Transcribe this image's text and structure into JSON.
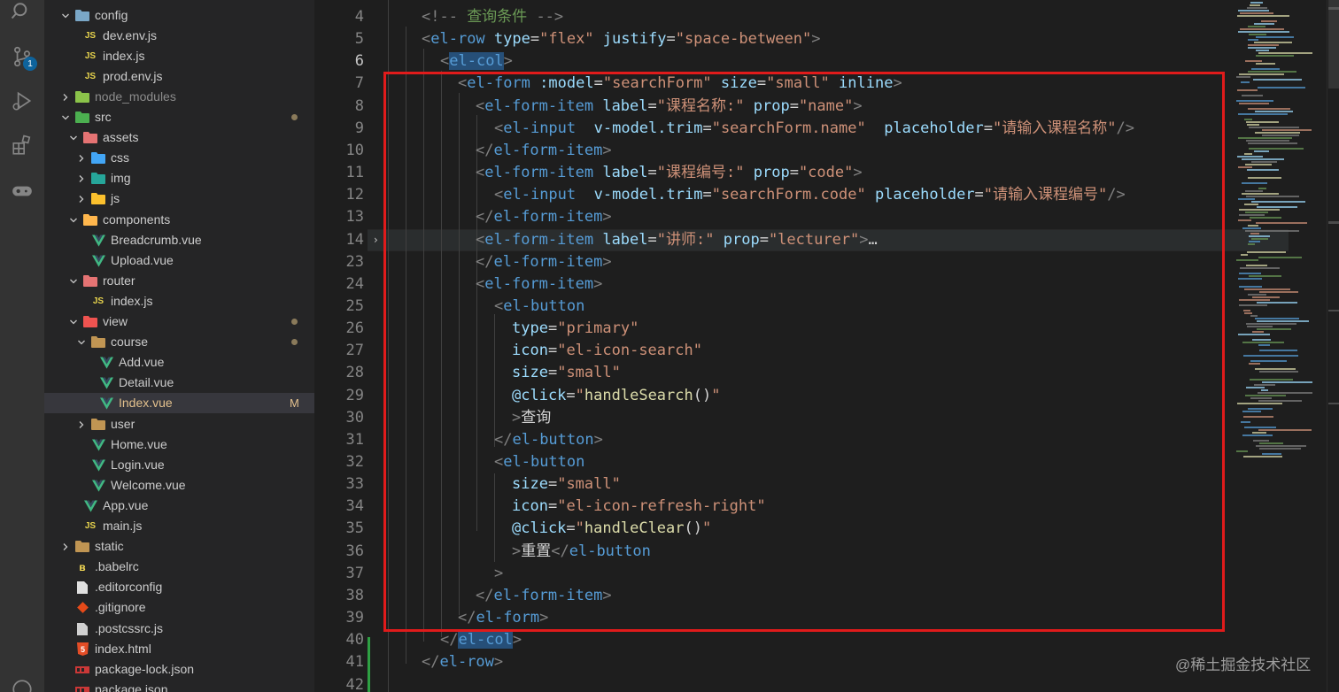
{
  "activity_bar": {
    "icons": [
      "search-icon",
      "source-control-icon",
      "run-debug-icon",
      "extensions-icon",
      "remote-icon"
    ],
    "scm_badge": "1"
  },
  "explorer": {
    "rows": [
      {
        "name": "config",
        "kind": "folder-open",
        "icon": "folder-config-icon",
        "color": "#7aa7c7"
      },
      {
        "name": "dev.env.js",
        "kind": "file",
        "icon": "js-file-icon",
        "color": "#e8d44d"
      },
      {
        "name": "index.js",
        "kind": "file",
        "icon": "js-file-icon",
        "color": "#e8d44d"
      },
      {
        "name": "prod.env.js",
        "kind": "file",
        "icon": "js-file-icon",
        "color": "#e8d44d"
      },
      {
        "name": "node_modules",
        "kind": "folder-closed",
        "icon": "folder-node-icon",
        "color": "#8bc34a"
      },
      {
        "name": "src",
        "kind": "folder-open",
        "icon": "folder-src-icon",
        "color": "#4caf50"
      },
      {
        "name": "assets",
        "kind": "folder-open",
        "icon": "folder-assets-icon",
        "color": "#e57373"
      },
      {
        "name": "css",
        "kind": "folder-closed",
        "icon": "folder-css-icon",
        "color": "#42a5f5"
      },
      {
        "name": "img",
        "kind": "folder-closed",
        "icon": "folder-images-icon",
        "color": "#26a69a"
      },
      {
        "name": "js",
        "kind": "folder-closed",
        "icon": "folder-js-icon",
        "color": "#fbc02d"
      },
      {
        "name": "components",
        "kind": "folder-open",
        "icon": "folder-components-icon",
        "color": "#ffb74d"
      },
      {
        "name": "Breadcrumb.vue",
        "kind": "file",
        "icon": "vue-file-icon",
        "color": "#41b883"
      },
      {
        "name": "Upload.vue",
        "kind": "file",
        "icon": "vue-file-icon",
        "color": "#41b883"
      },
      {
        "name": "router",
        "kind": "folder-open",
        "icon": "folder-router-icon",
        "color": "#e57373"
      },
      {
        "name": "index.js",
        "kind": "file",
        "icon": "js-file-icon",
        "color": "#e8d44d"
      },
      {
        "name": "view",
        "kind": "folder-open",
        "icon": "folder-view-icon",
        "color": "#ef5350"
      },
      {
        "name": "course",
        "kind": "folder-open",
        "icon": "folder-icon",
        "color": "#c09553"
      },
      {
        "name": "Add.vue",
        "kind": "file",
        "icon": "vue-file-icon",
        "color": "#41b883"
      },
      {
        "name": "Detail.vue",
        "kind": "file",
        "icon": "vue-file-icon",
        "color": "#41b883"
      },
      {
        "name": "Index.vue",
        "kind": "file",
        "icon": "vue-file-icon",
        "color": "#41b883"
      },
      {
        "name": "user",
        "kind": "folder-closed",
        "icon": "folder-icon",
        "color": "#c09553"
      },
      {
        "name": "Home.vue",
        "kind": "file",
        "icon": "vue-file-icon",
        "color": "#41b883"
      },
      {
        "name": "Login.vue",
        "kind": "file",
        "icon": "vue-file-icon",
        "color": "#41b883"
      },
      {
        "name": "Welcome.vue",
        "kind": "file",
        "icon": "vue-file-icon",
        "color": "#41b883"
      },
      {
        "name": "App.vue",
        "kind": "file",
        "icon": "vue-file-icon",
        "color": "#41b883"
      },
      {
        "name": "main.js",
        "kind": "file",
        "icon": "js-file-icon",
        "color": "#e8d44d"
      },
      {
        "name": "static",
        "kind": "folder-closed",
        "icon": "folder-icon",
        "color": "#c09553"
      },
      {
        "name": ".babelrc",
        "kind": "file",
        "icon": "babel-file-icon",
        "color": "#f5da55"
      },
      {
        "name": ".editorconfig",
        "kind": "file",
        "icon": "editorconfig-file-icon",
        "color": "#e0e0e0"
      },
      {
        "name": ".gitignore",
        "kind": "file",
        "icon": "git-file-icon",
        "color": "#e64a19"
      },
      {
        "name": ".postcssrc.js",
        "kind": "file",
        "icon": "postcss-file-icon",
        "color": "#d0d0d0"
      },
      {
        "name": "index.html",
        "kind": "file",
        "icon": "html-file-icon",
        "color": "#e44d26"
      },
      {
        "name": "package-lock.json",
        "kind": "file",
        "icon": "npm-file-icon",
        "color": "#cb3837"
      },
      {
        "name": "package.json",
        "kind": "file",
        "icon": "npm-file-icon",
        "color": "#cb3837"
      }
    ],
    "selected_file": "Index.vue",
    "modified_flag": "M"
  },
  "editor": {
    "active_line": "6",
    "line_numbers": [
      "4",
      "5",
      "6",
      "7",
      "8",
      "9",
      "10",
      "11",
      "12",
      "13",
      "14",
      "23",
      "24",
      "25",
      "26",
      "27",
      "28",
      "29",
      "30",
      "31",
      "32",
      "33",
      "34",
      "35",
      "36",
      "37",
      "38",
      "39",
      "40",
      "41",
      "42"
    ],
    "lines": [
      [
        [
          "t-punc",
          "<!-- "
        ],
        [
          "t-comm",
          "查询条件 "
        ],
        [
          "t-punc",
          "-->"
        ]
      ],
      [
        [
          "t-punc",
          "<"
        ],
        [
          "t-tag",
          "el-row"
        ],
        [
          "t-text",
          " "
        ],
        [
          "t-attr",
          "type"
        ],
        [
          "t-text",
          "="
        ],
        [
          "t-str",
          "\"flex\""
        ],
        [
          "t-text",
          " "
        ],
        [
          "t-attr",
          "justify"
        ],
        [
          "t-text",
          "="
        ],
        [
          "t-str",
          "\"space-between\""
        ],
        [
          "t-punc",
          ">"
        ]
      ],
      [
        [
          "t-punc",
          "<"
        ],
        [
          "t-hl",
          "el-col"
        ],
        [
          "t-punc",
          ">"
        ]
      ],
      [
        [
          "t-punc",
          "<"
        ],
        [
          "t-tag",
          "el-form"
        ],
        [
          "t-text",
          " "
        ],
        [
          "t-attr",
          ":model"
        ],
        [
          "t-text",
          "="
        ],
        [
          "t-str",
          "\"searchForm\""
        ],
        [
          "t-text",
          " "
        ],
        [
          "t-attr",
          "size"
        ],
        [
          "t-text",
          "="
        ],
        [
          "t-str",
          "\"small\""
        ],
        [
          "t-text",
          " "
        ],
        [
          "t-attr",
          "inline"
        ],
        [
          "t-punc",
          ">"
        ]
      ],
      [
        [
          "t-punc",
          "<"
        ],
        [
          "t-tag",
          "el-form-item"
        ],
        [
          "t-text",
          " "
        ],
        [
          "t-attr",
          "label"
        ],
        [
          "t-text",
          "="
        ],
        [
          "t-str",
          "\"课程名称:\""
        ],
        [
          "t-text",
          " "
        ],
        [
          "t-attr",
          "prop"
        ],
        [
          "t-text",
          "="
        ],
        [
          "t-str",
          "\"name\""
        ],
        [
          "t-punc",
          ">"
        ]
      ],
      [
        [
          "t-punc",
          "<"
        ],
        [
          "t-tag",
          "el-input"
        ],
        [
          "t-text",
          "  "
        ],
        [
          "t-attr",
          "v-model.trim"
        ],
        [
          "t-text",
          "="
        ],
        [
          "t-str",
          "\"searchForm.name\""
        ],
        [
          "t-text",
          "  "
        ],
        [
          "t-attr",
          "placeholder"
        ],
        [
          "t-text",
          "="
        ],
        [
          "t-str",
          "\"请输入课程名称\""
        ],
        [
          "t-punc",
          "/>"
        ]
      ],
      [
        [
          "t-punc",
          "</"
        ],
        [
          "t-tag",
          "el-form-item"
        ],
        [
          "t-punc",
          ">"
        ]
      ],
      [
        [
          "t-punc",
          "<"
        ],
        [
          "t-tag",
          "el-form-item"
        ],
        [
          "t-text",
          " "
        ],
        [
          "t-attr",
          "label"
        ],
        [
          "t-text",
          "="
        ],
        [
          "t-str",
          "\"课程编号:\""
        ],
        [
          "t-text",
          " "
        ],
        [
          "t-attr",
          "prop"
        ],
        [
          "t-text",
          "="
        ],
        [
          "t-str",
          "\"code\""
        ],
        [
          "t-punc",
          ">"
        ]
      ],
      [
        [
          "t-punc",
          "<"
        ],
        [
          "t-tag",
          "el-input"
        ],
        [
          "t-text",
          "  "
        ],
        [
          "t-attr",
          "v-model.trim"
        ],
        [
          "t-text",
          "="
        ],
        [
          "t-str",
          "\"searchForm.code\""
        ],
        [
          "t-text",
          " "
        ],
        [
          "t-attr",
          "placeholder"
        ],
        [
          "t-text",
          "="
        ],
        [
          "t-str",
          "\"请输入课程编号\""
        ],
        [
          "t-punc",
          "/>"
        ]
      ],
      [
        [
          "t-punc",
          "</"
        ],
        [
          "t-tag",
          "el-form-item"
        ],
        [
          "t-punc",
          ">"
        ]
      ],
      [
        [
          "t-punc",
          "<"
        ],
        [
          "t-tag",
          "el-form-item"
        ],
        [
          "t-text",
          " "
        ],
        [
          "t-attr",
          "label"
        ],
        [
          "t-text",
          "="
        ],
        [
          "t-str",
          "\"讲师:\""
        ],
        [
          "t-text",
          " "
        ],
        [
          "t-attr",
          "prop"
        ],
        [
          "t-text",
          "="
        ],
        [
          "t-str",
          "\"lecturer\""
        ],
        [
          "t-punc",
          ">"
        ],
        [
          "t-text",
          "…"
        ]
      ],
      [
        [
          "t-punc",
          "</"
        ],
        [
          "t-tag",
          "el-form-item"
        ],
        [
          "t-punc",
          ">"
        ]
      ],
      [
        [
          "t-punc",
          "<"
        ],
        [
          "t-tag",
          "el-form-item"
        ],
        [
          "t-punc",
          ">"
        ]
      ],
      [
        [
          "t-punc",
          "<"
        ],
        [
          "t-tag",
          "el-button"
        ]
      ],
      [
        [
          "t-attr",
          "type"
        ],
        [
          "t-text",
          "="
        ],
        [
          "t-str",
          "\"primary\""
        ]
      ],
      [
        [
          "t-attr",
          "icon"
        ],
        [
          "t-text",
          "="
        ],
        [
          "t-str",
          "\"el-icon-search\""
        ]
      ],
      [
        [
          "t-attr",
          "size"
        ],
        [
          "t-text",
          "="
        ],
        [
          "t-str",
          "\"small\""
        ]
      ],
      [
        [
          "t-attr",
          "@click"
        ],
        [
          "t-text",
          "="
        ],
        [
          "t-str",
          "\""
        ],
        [
          "t-fn",
          "handleSearch"
        ],
        [
          "t-text",
          "()"
        ],
        [
          "t-str",
          "\""
        ]
      ],
      [
        [
          "t-punc",
          ">"
        ],
        [
          "t-text",
          "查询"
        ]
      ],
      [
        [
          "t-punc",
          "</"
        ],
        [
          "t-tag",
          "el-button"
        ],
        [
          "t-punc",
          ">"
        ]
      ],
      [
        [
          "t-punc",
          "<"
        ],
        [
          "t-tag",
          "el-button"
        ]
      ],
      [
        [
          "t-attr",
          "size"
        ],
        [
          "t-text",
          "="
        ],
        [
          "t-str",
          "\"small\""
        ]
      ],
      [
        [
          "t-attr",
          "icon"
        ],
        [
          "t-text",
          "="
        ],
        [
          "t-str",
          "\"el-icon-refresh-right\""
        ]
      ],
      [
        [
          "t-attr",
          "@click"
        ],
        [
          "t-text",
          "="
        ],
        [
          "t-str",
          "\""
        ],
        [
          "t-fn",
          "handleClear"
        ],
        [
          "t-text",
          "()"
        ],
        [
          "t-str",
          "\""
        ]
      ],
      [
        [
          "t-punc",
          ">"
        ],
        [
          "t-text",
          "重置"
        ],
        [
          "t-punc",
          "</"
        ],
        [
          "t-tag",
          "el-button"
        ]
      ],
      [
        [
          "t-punc",
          ">"
        ]
      ],
      [
        [
          "t-punc",
          "</"
        ],
        [
          "t-tag",
          "el-form-item"
        ],
        [
          "t-punc",
          ">"
        ]
      ],
      [
        [
          "t-punc",
          "</"
        ],
        [
          "t-tag",
          "el-form"
        ],
        [
          "t-punc",
          ">"
        ]
      ],
      [
        [
          "t-punc",
          "</"
        ],
        [
          "t-hl",
          "el-col"
        ],
        [
          "t-punc",
          ">"
        ]
      ],
      [
        [
          "t-punc",
          "</"
        ],
        [
          "t-tag",
          "el-row"
        ],
        [
          "t-punc",
          ">"
        ]
      ],
      []
    ]
  },
  "watermark": "@稀土掘金技术社区"
}
